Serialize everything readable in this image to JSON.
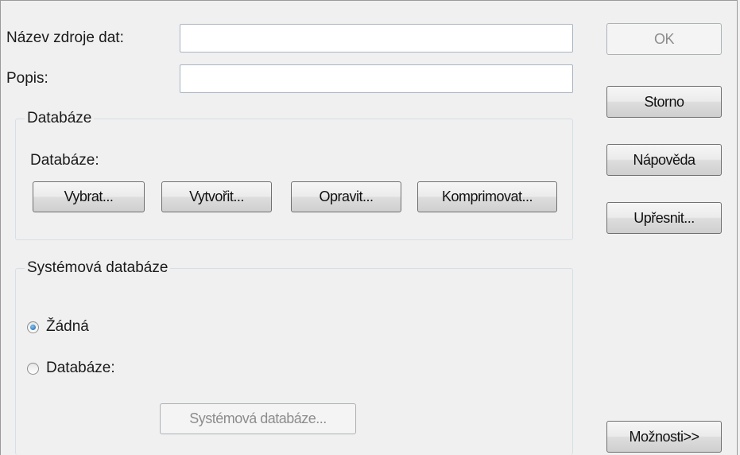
{
  "fields": {
    "datasource_label": "Název zdroje dat:",
    "datasource_value": "",
    "description_label": "Popis:",
    "description_value": ""
  },
  "database_group": {
    "title": "Databáze",
    "db_label": "Databáze:",
    "buttons": {
      "select": "Vybrat...",
      "create": "Vytvořit...",
      "repair": "Opravit...",
      "compact": "Komprimovat..."
    }
  },
  "system_db_group": {
    "title": "Systémová databáze",
    "option_none": "Žádná",
    "option_database": "Databáze:",
    "selected": "Žádná",
    "system_db_button": "Systémová databáze..."
  },
  "side_buttons": {
    "ok": "OK",
    "cancel": "Storno",
    "help": "Nápověda",
    "advanced": "Upřesnit...",
    "options": "Možnosti>>"
  }
}
